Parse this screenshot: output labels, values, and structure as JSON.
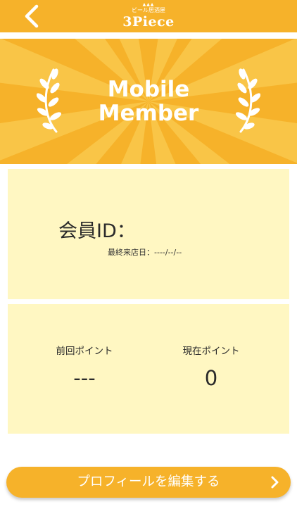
{
  "header": {
    "back_icon": "chevron-left-icon",
    "logo": {
      "sub": "ビール居酒屋",
      "main": "3Piece"
    }
  },
  "banner": {
    "title_line1": "Mobile",
    "title_line2": "Member",
    "decoration_icon": "laurel-icon"
  },
  "member": {
    "id_label": "会員ID：",
    "last_visit": "最終来店日：----/--/--"
  },
  "points": {
    "previous_label": "前回ポイント",
    "previous_value": "---",
    "current_label": "現在ポイント",
    "current_value": "0"
  },
  "edit_profile": {
    "label": "プロフィールを編集する",
    "icon": "chevron-right-icon"
  },
  "colors": {
    "accent": "#f6b22a",
    "card_background": "#fff7c2",
    "text": "#2a2a2a"
  }
}
